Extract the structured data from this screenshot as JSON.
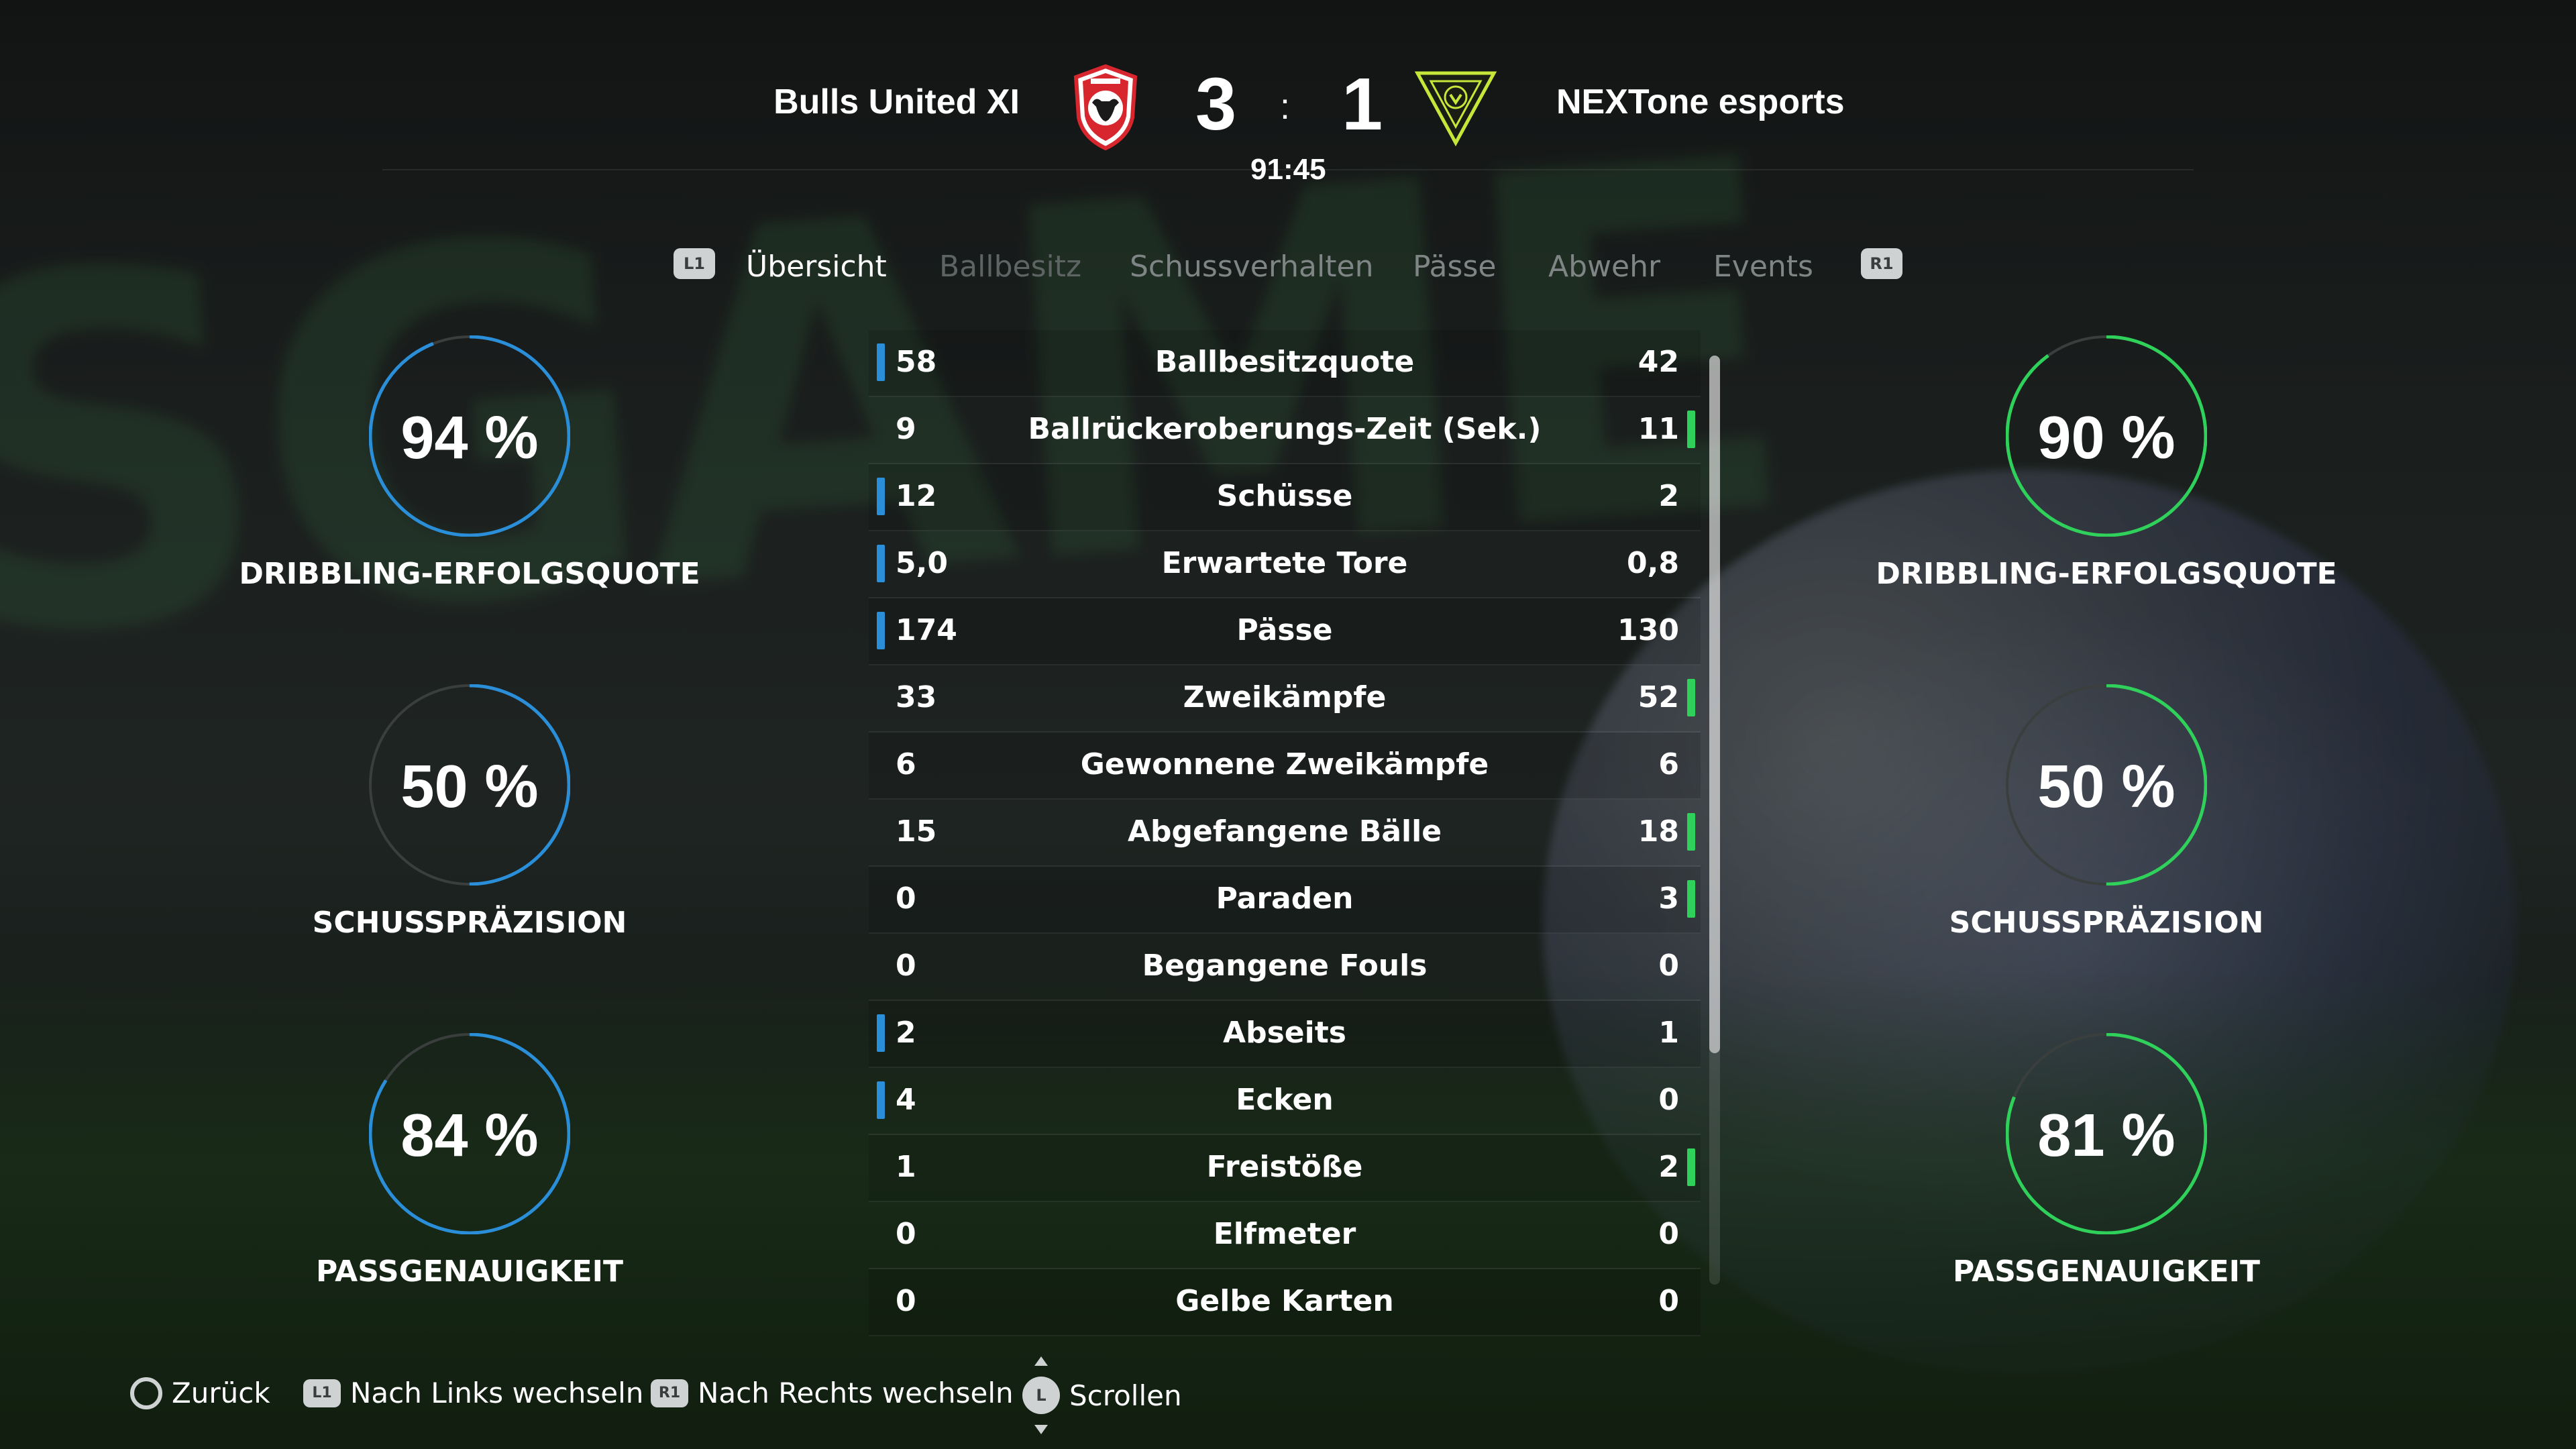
{
  "header": {
    "home_team": "Bulls United XI",
    "away_team": "NEXTone esports",
    "home_score": "3",
    "score_separator": ":",
    "away_score": "1",
    "clock": "91:45",
    "home_crest_icon": "bull-shield-crest",
    "away_crest_icon": "nextone-triangle-crest"
  },
  "tabs": {
    "left_shoulder": "L1",
    "right_shoulder": "R1",
    "items": [
      "Übersicht",
      "Ballbesitz",
      "Schussverhalten",
      "Pässe",
      "Abwehr",
      "Events"
    ],
    "active_index": 0
  },
  "stats": [
    {
      "label": "Ballbesitzquote",
      "home": "58",
      "away": "42",
      "lead": "home"
    },
    {
      "label": "Ballrückeroberungs-Zeit (Sek.)",
      "home": "9",
      "away": "11",
      "lead": "away"
    },
    {
      "label": "Schüsse",
      "home": "12",
      "away": "2",
      "lead": "home"
    },
    {
      "label": "Erwartete Tore",
      "home": "5,0",
      "away": "0,8",
      "lead": "home"
    },
    {
      "label": "Pässe",
      "home": "174",
      "away": "130",
      "lead": "home"
    },
    {
      "label": "Zweikämpfe",
      "home": "33",
      "away": "52",
      "lead": "away"
    },
    {
      "label": "Gewonnene Zweikämpfe",
      "home": "6",
      "away": "6",
      "lead": "none"
    },
    {
      "label": "Abgefangene Bälle",
      "home": "15",
      "away": "18",
      "lead": "away"
    },
    {
      "label": "Paraden",
      "home": "0",
      "away": "3",
      "lead": "away"
    },
    {
      "label": "Begangene Fouls",
      "home": "0",
      "away": "0",
      "lead": "none"
    },
    {
      "label": "Abseits",
      "home": "2",
      "away": "1",
      "lead": "home"
    },
    {
      "label": "Ecken",
      "home": "4",
      "away": "0",
      "lead": "home"
    },
    {
      "label": "Freistöße",
      "home": "1",
      "away": "2",
      "lead": "away"
    },
    {
      "label": "Elfmeter",
      "home": "0",
      "away": "0",
      "lead": "none"
    },
    {
      "label": "Gelbe Karten",
      "home": "0",
      "away": "0",
      "lead": "none"
    }
  ],
  "rings": {
    "home": [
      {
        "value": "94 %",
        "label": "DRIBBLING-ERFOLGSQUOTE",
        "fraction": 0.94
      },
      {
        "value": "50 %",
        "label": "SCHUSSPRÄZISION",
        "fraction": 0.5
      },
      {
        "value": "84 %",
        "label": "PASSGENAUIGKEIT",
        "fraction": 0.84
      }
    ],
    "away": [
      {
        "value": "90 %",
        "label": "DRIBBLING-ERFOLGSQUOTE",
        "fraction": 0.9
      },
      {
        "value": "50 %",
        "label": "SCHUSSPRÄZISION",
        "fraction": 0.5
      },
      {
        "value": "81 %",
        "label": "PASSGENAUIGKEIT",
        "fraction": 0.81
      }
    ]
  },
  "colors": {
    "home_accent": "#2a8fd8",
    "away_accent": "#2fd15b",
    "ring_track": "#3a3f3e"
  },
  "footer": {
    "back_label": "Zurück",
    "left_label": "Nach Links wechseln",
    "right_label": "Nach Rechts wechseln",
    "scroll_label": "Scrollen",
    "left_button": "L1",
    "right_button": "R1",
    "stick_button": "L"
  },
  "background": {
    "banner_text": "SGAME"
  }
}
